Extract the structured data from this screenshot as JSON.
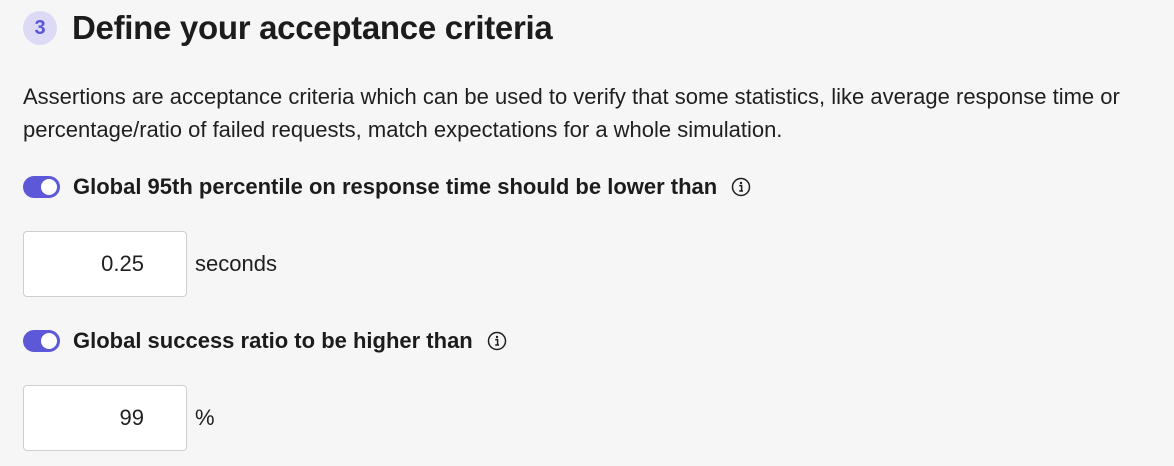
{
  "step": {
    "number": "3",
    "title": "Define your acceptance criteria"
  },
  "description": "Assertions are acceptance criteria which can be used to verify that some statistics, like average response time or percentage/ratio of failed requests, match expectations for a whole simulation.",
  "assertions": [
    {
      "label": "Global 95th percentile on response time should be lower than",
      "enabled": true,
      "value": "0.25",
      "unit": "seconds",
      "icon": "info-icon"
    },
    {
      "label": "Global success ratio to be higher than",
      "enabled": true,
      "value": "99",
      "unit": "%",
      "icon": "info-icon"
    }
  ],
  "colors": {
    "accent": "#5d58d8",
    "badge_background": "#dcdaf5",
    "page_background": "#f6f6f6"
  }
}
